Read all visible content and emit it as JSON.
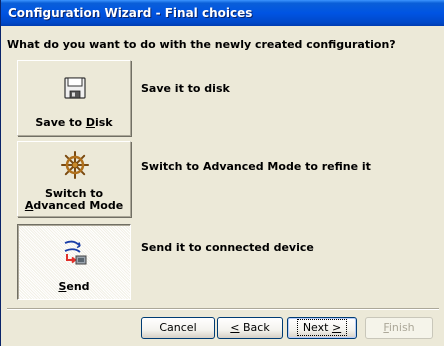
{
  "window": {
    "title": "Configuration Wizard - Final choices"
  },
  "question": "What do you want to do with the newly created configuration?",
  "choices": [
    {
      "label_pre": "Save to ",
      "label_key": "D",
      "label_post": "isk",
      "description": "Save it to disk",
      "icon": "floppy-disk-icon"
    },
    {
      "label_pre": "Switch to ",
      "label_key": "A",
      "label_post": "dvanced Mode",
      "description": "Switch to Advanced Mode to refine it",
      "icon": "ship-wheel-icon"
    },
    {
      "label_pre": "",
      "label_key": "S",
      "label_post": "end",
      "description": "Send it to connected device",
      "icon": "send-to-device-icon",
      "selected": true
    }
  ],
  "buttons": {
    "cancel": "Cancel",
    "back_key": "<",
    "back_rest": " Back",
    "next_rest": "Next ",
    "next_key": ">",
    "finish_key": "F",
    "finish_rest": "inish"
  }
}
